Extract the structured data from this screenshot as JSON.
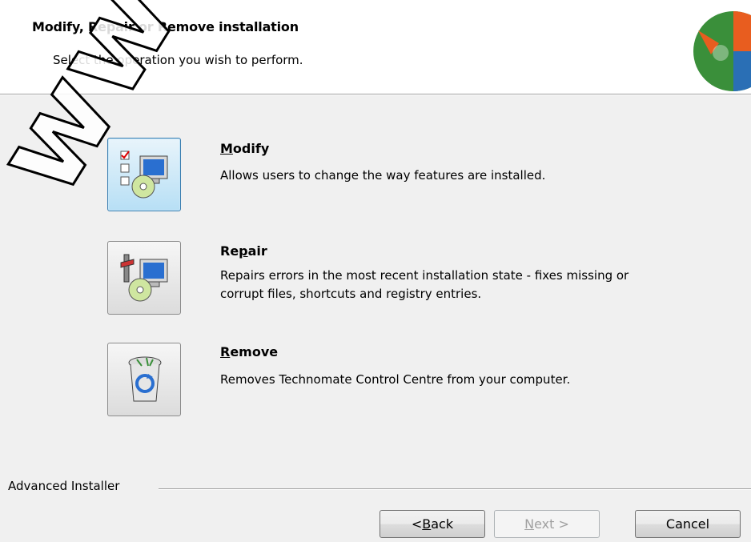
{
  "header": {
    "title": "Modify, Repair or Remove installation",
    "subtitle": "Select the operation you wish to perform."
  },
  "options": [
    {
      "id": "modify",
      "title_mnemonic": "M",
      "title_rest": "odify",
      "description": "Allows users to change the way features are installed.",
      "selected": true
    },
    {
      "id": "repair",
      "title_pre": "Re",
      "title_mnemonic": "p",
      "title_rest": "air",
      "description": "Repairs errors in the most recent installation state - fixes missing or corrupt files, shortcuts and registry entries.",
      "selected": false
    },
    {
      "id": "remove",
      "title_mnemonic": "R",
      "title_rest": "emove",
      "description": "Removes Technomate Control Centre from your computer.",
      "selected": false
    }
  ],
  "footer": {
    "group_label": "Advanced Installer",
    "back_pre": "< ",
    "back_mnemonic": "B",
    "back_rest": "ack",
    "next_mnemonic": "N",
    "next_rest": "ext >",
    "next_enabled": false,
    "cancel_label": "Cancel"
  },
  "watermark": "www.atis-s",
  "icons": {
    "logo": "installer-puzzle-icon",
    "modify": "modify-computer-cd-icon",
    "repair": "repair-computer-cd-icon",
    "remove": "recycle-bin-icon"
  },
  "colors": {
    "selected_border": "#3c7fb1",
    "selected_fill": "#b7dff5",
    "window_bg": "#f0f0f0"
  }
}
